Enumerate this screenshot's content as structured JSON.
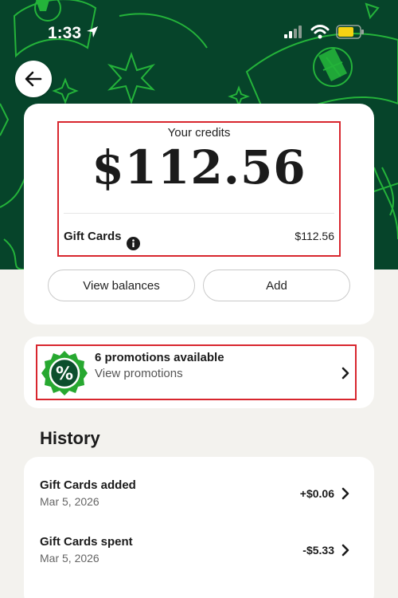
{
  "status_bar": {
    "time": "1:33",
    "icons": [
      "location-arrow-icon",
      "signal-icon",
      "wifi-icon",
      "battery-icon"
    ]
  },
  "colors": {
    "hero_bg": "#06442a",
    "pattern": "#24b33a",
    "highlight": "#d8262e",
    "badge": "#27a830"
  },
  "credits": {
    "title": "Your credits",
    "amount": "$112.56",
    "gift_cards_label": "Gift Cards",
    "gift_cards_value": "$112.56",
    "view_balances_label": "View balances",
    "add_label": "Add"
  },
  "promotions": {
    "title": "6 promotions available",
    "subtitle": "View promotions",
    "badge_symbol": "%"
  },
  "history": {
    "title": "History",
    "items": [
      {
        "title": "Gift Cards added",
        "date": "Mar 5, 2026",
        "amount": "+$0.06"
      },
      {
        "title": "Gift Cards spent",
        "date": "Mar 5, 2026",
        "amount": "-$5.33"
      }
    ]
  }
}
